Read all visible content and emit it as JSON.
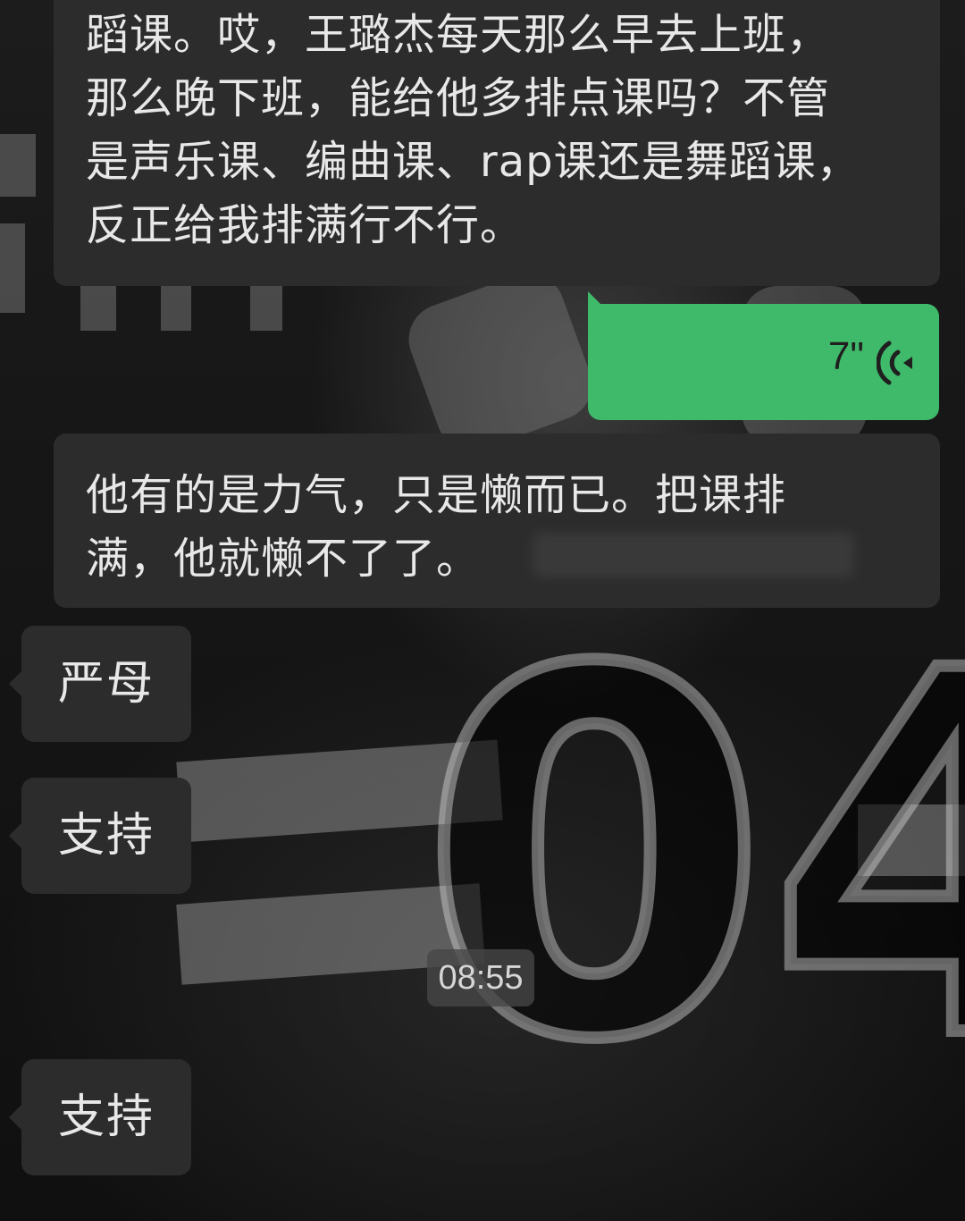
{
  "chat": {
    "messages": [
      {
        "side": "incoming",
        "type": "text",
        "lines": [
          "蹈课。哎，王璐杰每天那么早去上班，",
          "那么晚下班，能给他多排点课吗？不管",
          "是声乐课、编曲课、rap课还是舞蹈课，",
          "反正给我排满行不行。"
        ]
      },
      {
        "side": "outgoing",
        "type": "voice",
        "duration": "7\"",
        "icon": "voice-wave-icon"
      },
      {
        "side": "incoming",
        "type": "text",
        "lines": [
          "他有的是力气，只是懒而已。把课排",
          "满，他就懒不了了。"
        ]
      },
      {
        "side": "incoming",
        "type": "text",
        "text": "严母"
      },
      {
        "side": "incoming",
        "type": "text",
        "text": "支持"
      },
      {
        "side": "incoming",
        "type": "text",
        "text": "支持"
      }
    ],
    "timestamp": "08:55"
  },
  "colors": {
    "incoming_bubble": "#2c2c2c",
    "outgoing_bubble": "#3fba6a",
    "text": "#e8e8e8"
  },
  "wallpaper": {
    "jersey_number": "04"
  }
}
